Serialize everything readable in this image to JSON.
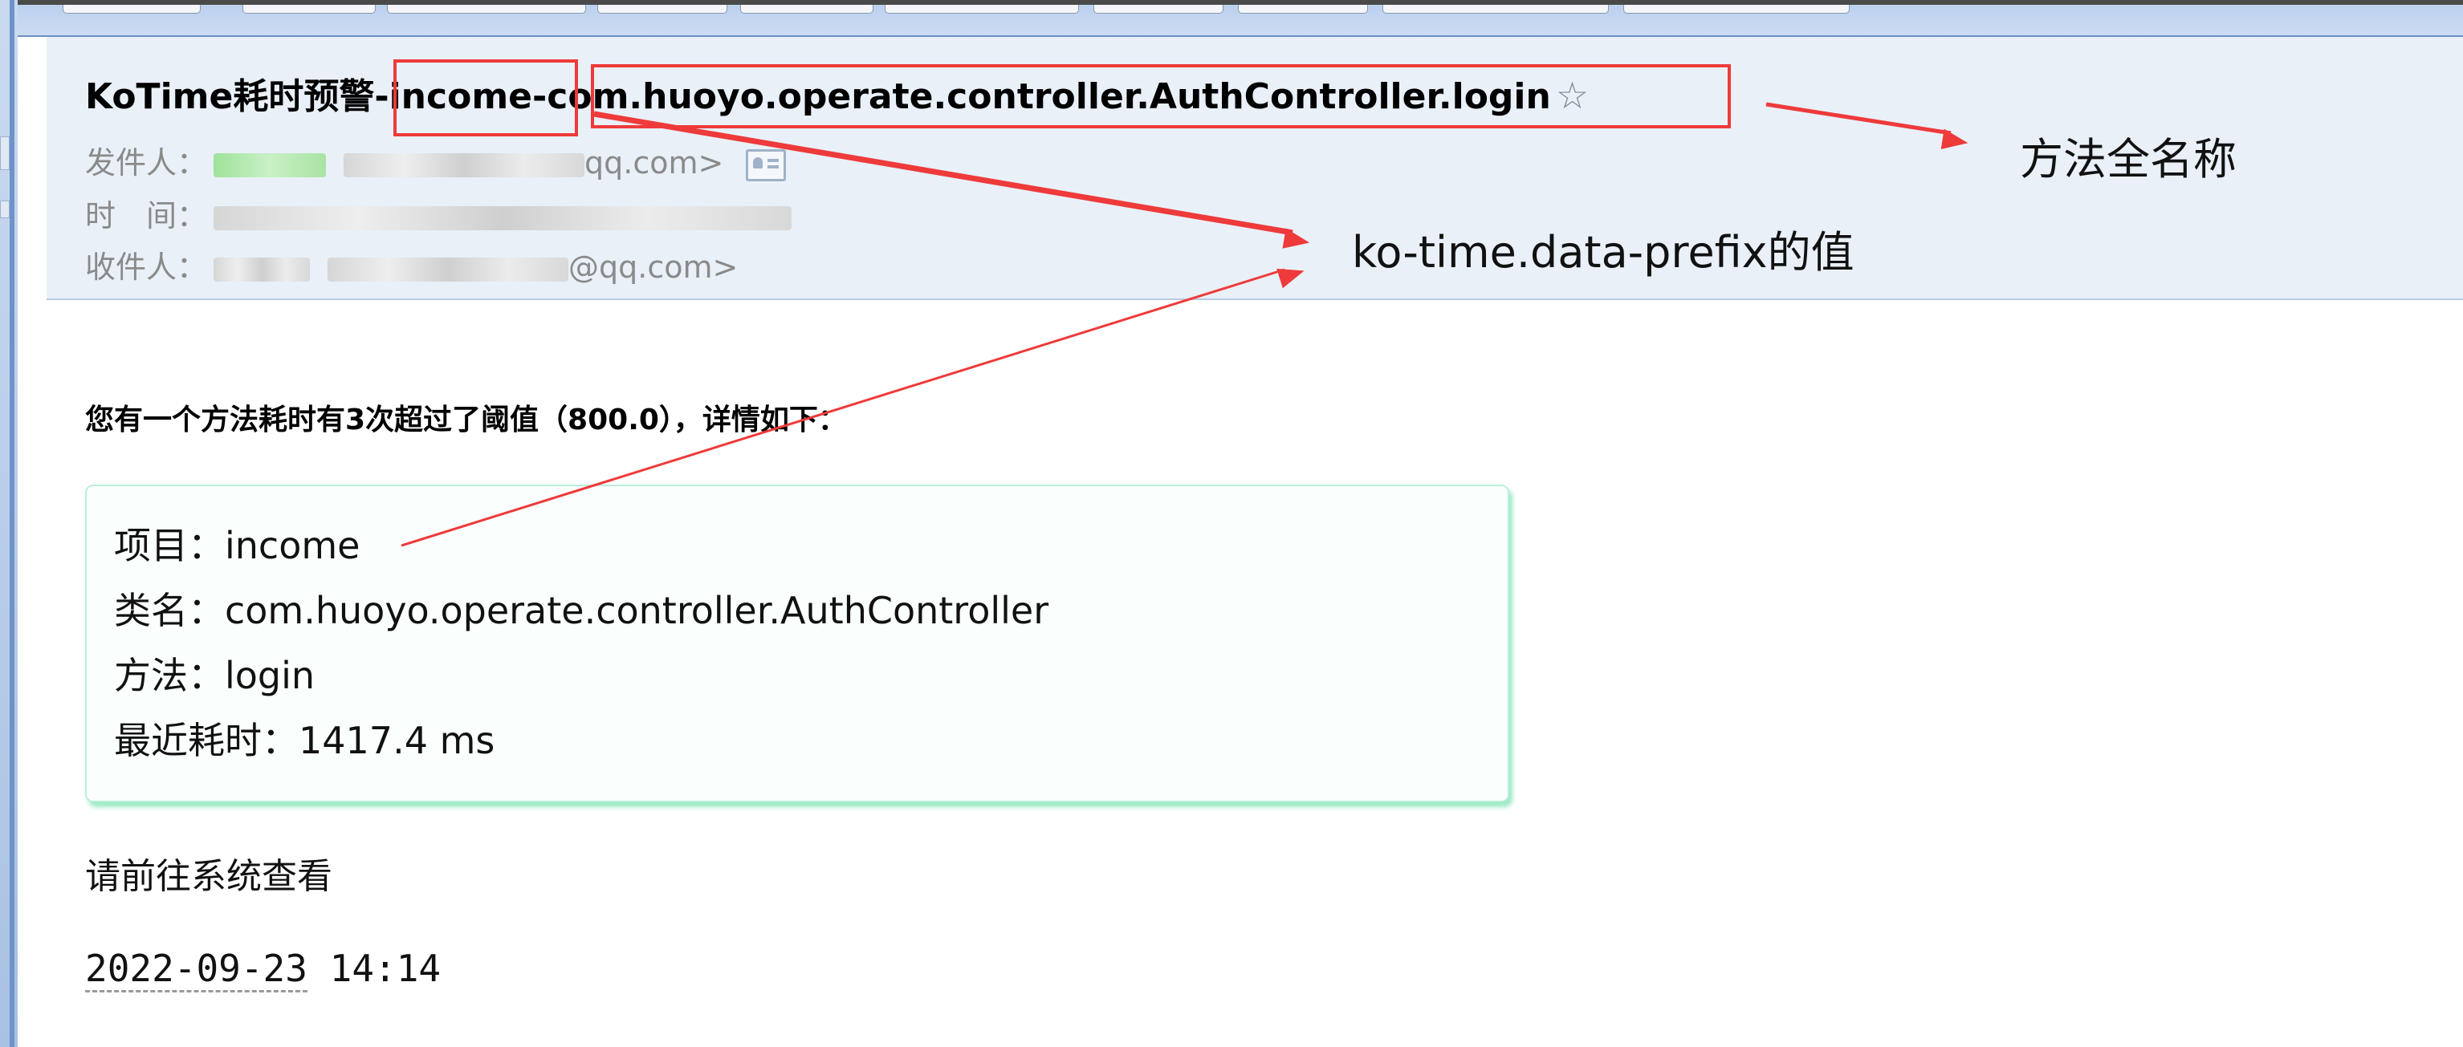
{
  "email": {
    "subject": "KoTime耗时预警-income-com.huoyo.operate.controller.AuthController.login",
    "star_icon": "star-icon",
    "meta": {
      "sender_label": "发件人：",
      "sender_suffix": "qq.com>",
      "time_label": "时　间：",
      "recipient_label": "收件人：",
      "recipient_suffix": "@qq.com>"
    }
  },
  "body": {
    "summary": "您有一个方法耗时有3次超过了阈值（800.0），详情如下：",
    "details": [
      "项目：income",
      "类名：com.huoyo.operate.controller.AuthController",
      "方法：login",
      "最近耗时：1417.4 ms"
    ],
    "goto": "请前往系统查看",
    "date": "2022-09-23",
    "time": " 14:14"
  },
  "annotations": {
    "method_fullname": "方法全名称",
    "data_prefix": "ko-time.data-prefix的值",
    "color": "#ee3a3a"
  }
}
